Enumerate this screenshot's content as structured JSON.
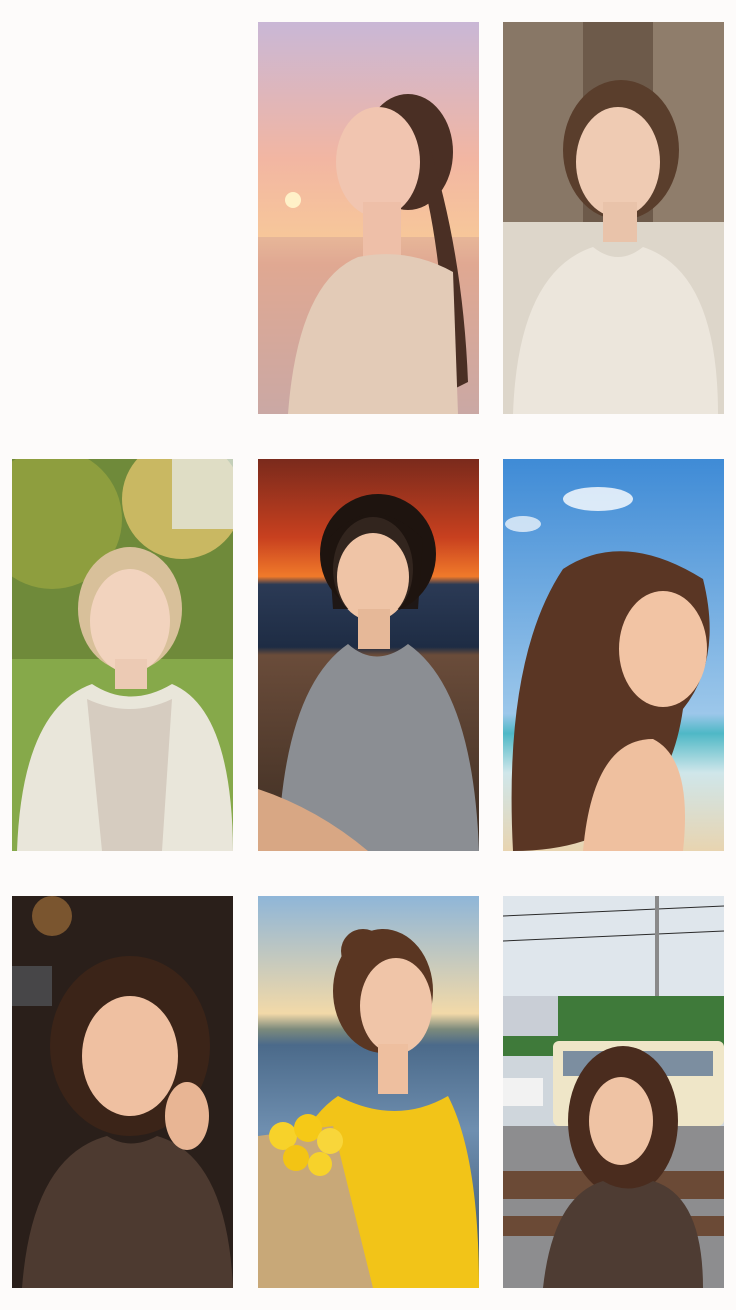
{
  "gallery": {
    "items": [
      {
        "id": "empty",
        "scene": "empty",
        "accent": "#fdfbfa"
      },
      {
        "id": "p1",
        "scene": "sunset-sea-ponytail",
        "accent": "#f3a88a",
        "icon": "portrait-photo-icon"
      },
      {
        "id": "p2",
        "scene": "indoor-cream-sweater",
        "accent": "#e8e2d6",
        "icon": "portrait-photo-icon"
      },
      {
        "id": "p3",
        "scene": "park-hoodie",
        "accent": "#7d9a4a",
        "icon": "portrait-photo-icon"
      },
      {
        "id": "p4",
        "scene": "beach-sunset-grey-sweater",
        "accent": "#d9542a",
        "icon": "portrait-photo-icon"
      },
      {
        "id": "p5",
        "scene": "blue-sky-beach-long-hair",
        "accent": "#5b9fd8",
        "icon": "portrait-photo-icon"
      },
      {
        "id": "p6",
        "scene": "dark-cafe-curly-hair",
        "accent": "#3a2a22",
        "icon": "portrait-photo-icon"
      },
      {
        "id": "p7",
        "scene": "waterfront-yellow-flowers",
        "accent": "#f1c418",
        "icon": "portrait-photo-icon"
      },
      {
        "id": "p8",
        "scene": "city-bus-bench",
        "accent": "#cfd8dc",
        "icon": "portrait-photo-icon"
      }
    ]
  },
  "colors": {
    "background": "#fdfbfa"
  }
}
